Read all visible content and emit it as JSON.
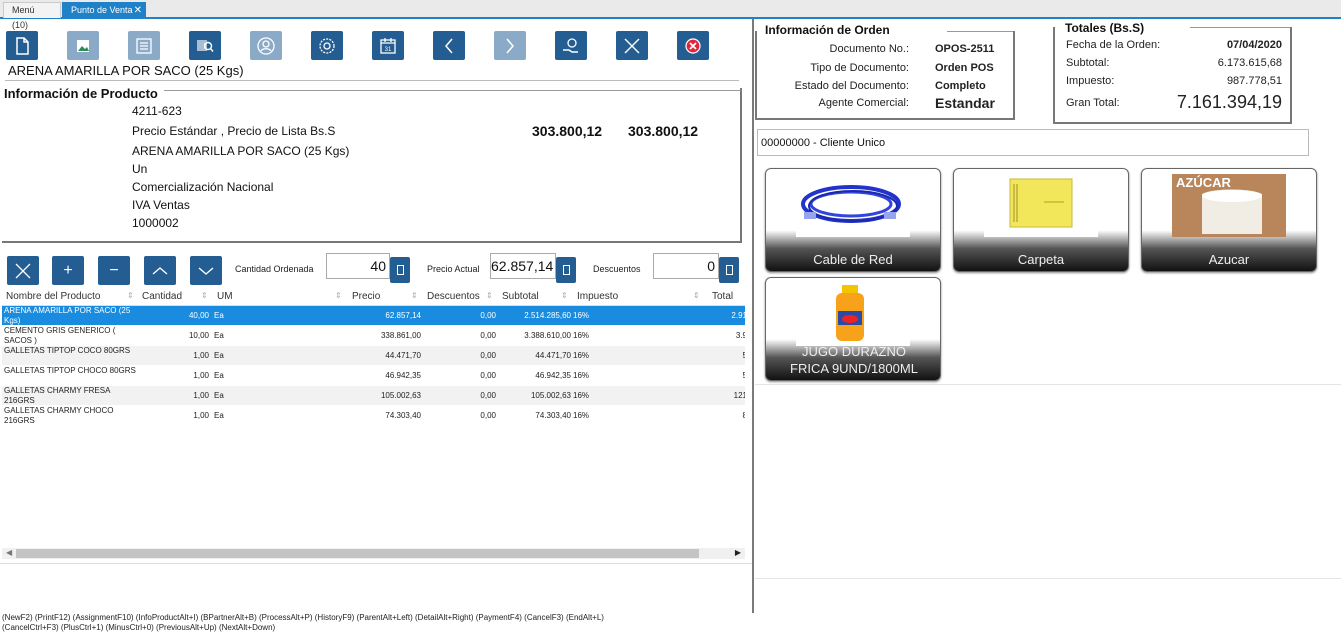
{
  "tabs": [
    {
      "label": "Menú (10)"
    },
    {
      "label": "Punto de Venta"
    }
  ],
  "toolbar": {
    "buttons": [
      "new-document",
      "print",
      "assignment",
      "info-product",
      "business-partner",
      "process",
      "history",
      "previous",
      "next",
      "payment",
      "cancel",
      "end"
    ]
  },
  "product": {
    "title": "ARENA AMARILLA POR SACO (25 Kgs)",
    "info_legend": "Información de Producto",
    "code": "4211-623",
    "price_list_label": "Precio Estándar , Precio de Lista Bs.S",
    "price_std": "303.800,12",
    "price_list": "303.800,12",
    "name": "ARENA AMARILLA POR SACO (25 Kgs)",
    "uom": "Un",
    "category": "Comercialización Nacional",
    "tax": "IVA Ventas",
    "upc": "1000002"
  },
  "line_editor": {
    "qty_label": "Cantidad Ordenada",
    "qty_value": "40",
    "price_label": "Precio Actual",
    "price_value": "62.857,14",
    "discount_label": "Descuentos",
    "discount_value": "0"
  },
  "grid": {
    "columns": [
      "Nombre del Producto",
      "Cantidad",
      "UM",
      "Precio",
      "Descuentos",
      "Subtotal",
      "Impuesto",
      "Total"
    ],
    "rows": [
      {
        "name": "ARENA AMARILLA POR SACO (25 Kgs)",
        "qty": "40,00",
        "um": "Ea",
        "price": "62.857,14",
        "disc": "0,00",
        "subtotal": "2.514.285,60",
        "tax": "16%",
        "total": "2.91"
      },
      {
        "name": "CEMENTO GRIS GENERICO ( SACOS )",
        "qty": "10,00",
        "um": "Ea",
        "price": "338.861,00",
        "disc": "0,00",
        "subtotal": "3.388.610,00",
        "tax": "16%",
        "total": "3.9"
      },
      {
        "name": "GALLETAS TIPTOP COCO 80GRS",
        "qty": "1,00",
        "um": "Ea",
        "price": "44.471,70",
        "disc": "0,00",
        "subtotal": "44.471,70",
        "tax": "16%",
        "total": "5"
      },
      {
        "name": "GALLETAS TIPTOP CHOCO 80GRS",
        "qty": "1,00",
        "um": "Ea",
        "price": "46.942,35",
        "disc": "0,00",
        "subtotal": "46.942,35",
        "tax": "16%",
        "total": "5"
      },
      {
        "name": "GALLETAS CHARMY FRESA 216GRS",
        "qty": "1,00",
        "um": "Ea",
        "price": "105.002,63",
        "disc": "0,00",
        "subtotal": "105.002,63",
        "tax": "16%",
        "total": "121"
      },
      {
        "name": "GALLETAS CHARMY CHOCO 216GRS",
        "qty": "1,00",
        "um": "Ea",
        "price": "74.303,40",
        "disc": "0,00",
        "subtotal": "74.303,40",
        "tax": "16%",
        "total": "8"
      }
    ]
  },
  "shortcuts": {
    "line1": "(NewF2) (PrintF12) (AssignmentF10) (InfoProductAlt+I) (BPartnerAlt+B) (ProcessAlt+P) (HistoryF9) (ParentAlt+Left) (DetailAlt+Right) (PaymentF4) (CancelF3) (EndAlt+L)",
    "line2": "(CancelCtrl+F3) (PlusCtrl+1) (MinusCtrl+0) (PreviousAlt+Up) (NextAlt+Down)"
  },
  "order": {
    "legend": "Información de Orden",
    "doc_no_label": "Documento No.:",
    "doc_no": "OPOS-2511",
    "doc_type_label": "Tipo de Documento:",
    "doc_type": "Orden POS",
    "status_label": "Estado del Documento:",
    "status": "Completo",
    "agent_label": "Agente Comercial:",
    "agent": "Estandar"
  },
  "totals": {
    "legend": "Totales (Bs.S)",
    "date_label": "Fecha de la Orden:",
    "date": "07/04/2020",
    "subtotal_label": "Subtotal:",
    "subtotal": "6.173.615,68",
    "tax_label": "Impuesto:",
    "tax": "987.778,51",
    "grand_label": "Gran Total:",
    "grand": "7.161.394,19"
  },
  "customer": {
    "value": "00000000 - Cliente Unico"
  },
  "products": [
    {
      "label": "Cable de Red"
    },
    {
      "label": "Carpeta"
    },
    {
      "label": "Azucar",
      "image_text": "AZÚCAR"
    },
    {
      "label": "JUGO DURAZNO FRICA 9UND/1800ML"
    }
  ],
  "colors": {
    "accent": "#245d91",
    "selection": "#1a8ce0",
    "tab_active": "#1f82c8"
  }
}
